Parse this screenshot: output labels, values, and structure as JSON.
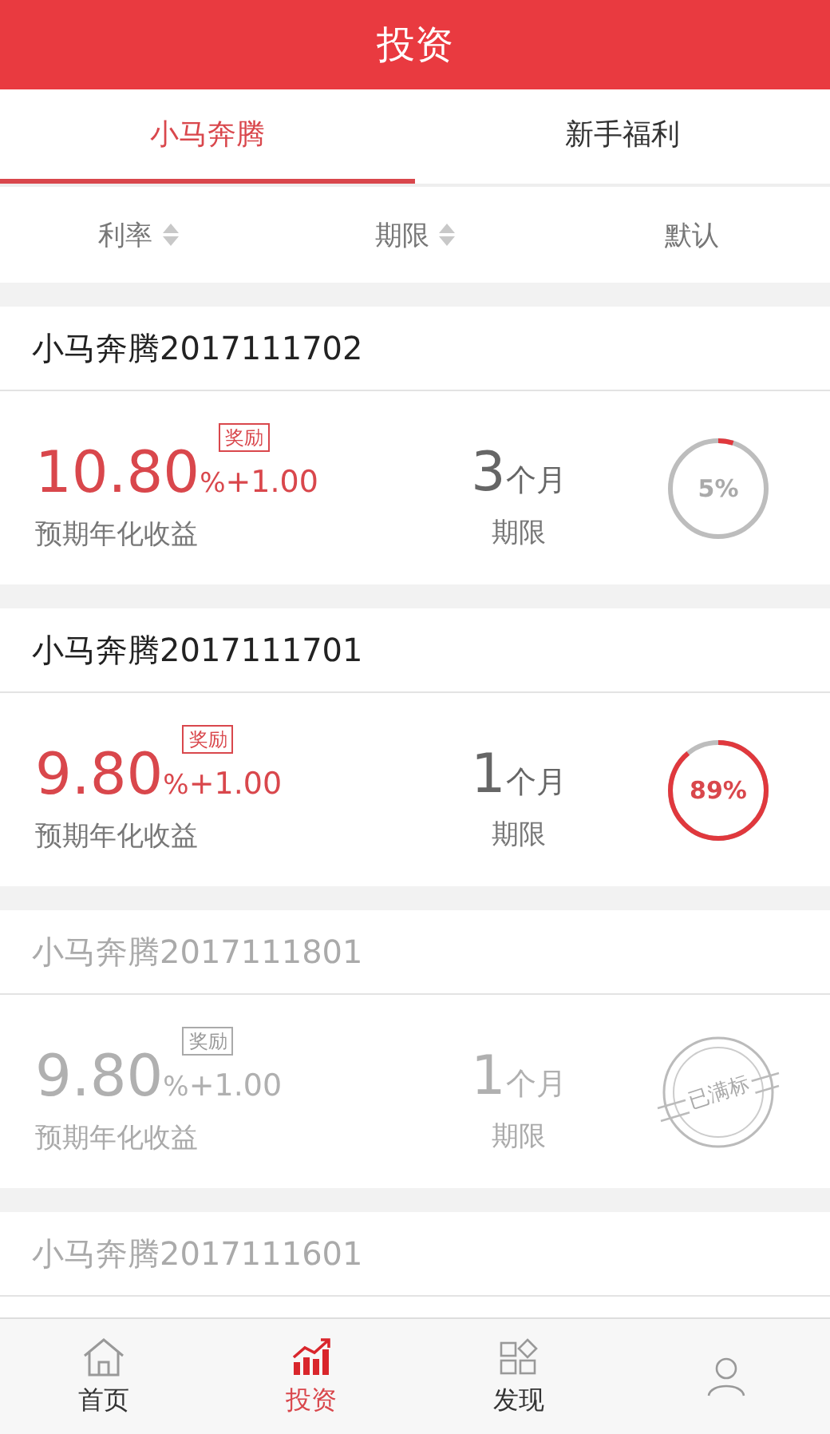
{
  "header": {
    "title": "投资"
  },
  "tabs": [
    {
      "label": "小马奔腾",
      "selected": true
    },
    {
      "label": "新手福利",
      "selected": false
    }
  ],
  "sort_bar": [
    {
      "label": "利率",
      "sortable": true
    },
    {
      "label": "期限",
      "sortable": true
    },
    {
      "label": "默认",
      "sortable": false
    }
  ],
  "products": [
    {
      "name": "小马奔腾2017111702",
      "sold_out": false,
      "rate": "10.80",
      "rate_unit": "%",
      "bonus": "+1.00",
      "bonus_tag": "奖励",
      "rate_label": "预期年化收益",
      "term": "3",
      "term_unit": "个月",
      "term_label": "期限",
      "progress": {
        "level": 0.05,
        "reading": "5%"
      }
    },
    {
      "name": "小马奔腾2017111701",
      "sold_out": false,
      "rate": "9.80",
      "rate_unit": "%",
      "bonus": "+1.00",
      "bonus_tag": "奖励",
      "rate_label": "预期年化收益",
      "term": "1",
      "term_unit": "个月",
      "term_label": "期限",
      "progress": {
        "level": 0.89,
        "reading": "89%"
      }
    },
    {
      "name": "小马奔腾2017111801",
      "sold_out": true,
      "rate": "9.80",
      "rate_unit": "%",
      "bonus": "+1.00",
      "bonus_tag": "奖励",
      "rate_label": "预期年化收益",
      "term": "1",
      "term_unit": "个月",
      "term_label": "期限",
      "stamp": "已满标"
    },
    {
      "name": "小马奔腾2017111601",
      "sold_out": true
    }
  ],
  "bottom_nav": [
    {
      "kind": "home",
      "label": "首页",
      "selected": false
    },
    {
      "kind": "invest",
      "label": "投资",
      "selected": true
    },
    {
      "kind": "discover",
      "label": "发现",
      "selected": false
    },
    {
      "kind": "profile",
      "selected": false
    }
  ]
}
